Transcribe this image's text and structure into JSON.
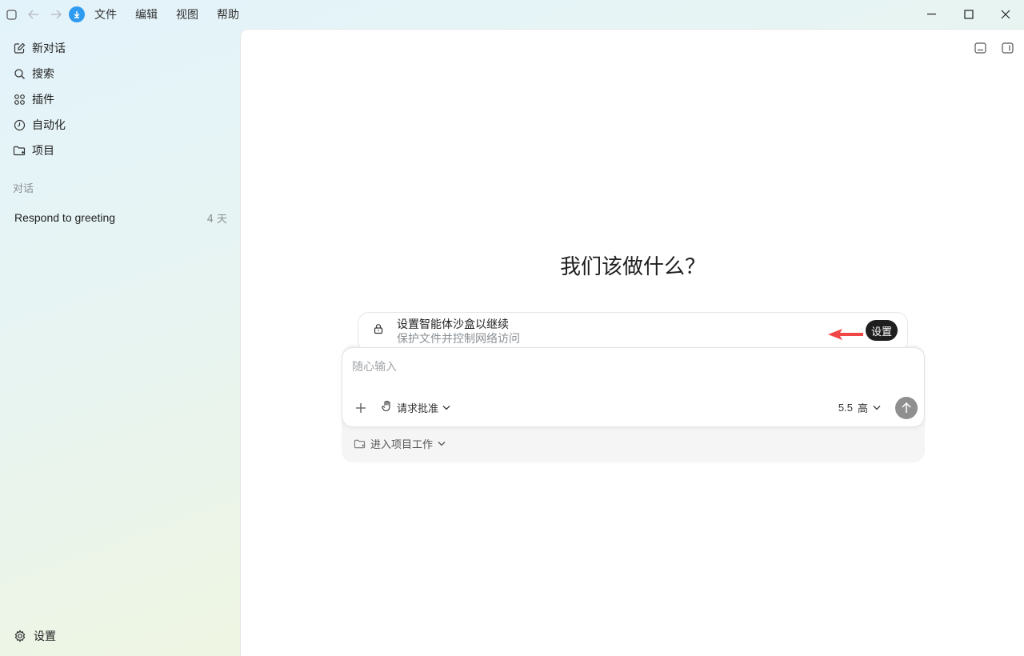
{
  "menu": [
    "文件",
    "编辑",
    "视图",
    "帮助"
  ],
  "sidebar": {
    "items": [
      {
        "label": "新对话",
        "icon": "edit-icon"
      },
      {
        "label": "搜索",
        "icon": "search-icon"
      },
      {
        "label": "插件",
        "icon": "grid-icon"
      },
      {
        "label": "自动化",
        "icon": "clock-icon"
      },
      {
        "label": "项目",
        "icon": "folder-icon"
      }
    ],
    "section_title": "对话",
    "conversations": [
      {
        "title": "Respond to greeting",
        "age": "4 天"
      }
    ],
    "settings_label": "设置"
  },
  "main": {
    "heading": "我们该做什么？",
    "sandbox": {
      "title": "设置智能体沙盒以继续",
      "subtitle": "保护文件并控制网络访问",
      "button": "设置"
    },
    "composer": {
      "placeholder": "随心输入",
      "approval_label": "请求批准",
      "model_version": "5.5",
      "model_level": "高"
    },
    "project_label": "进入项目工作"
  },
  "colors": {
    "accent": "#2f9bf0",
    "annotation_arrow": "#f04646",
    "dark_button": "#1f1f1f"
  }
}
